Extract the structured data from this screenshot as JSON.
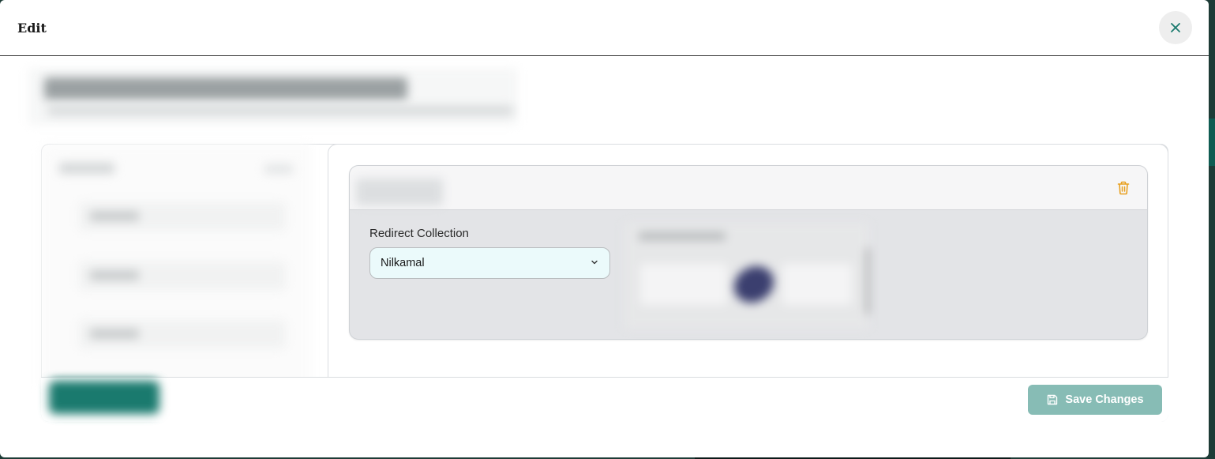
{
  "modal": {
    "title": "Edit",
    "close_icon": "close-icon"
  },
  "item": {
    "delete_icon": "trash-icon",
    "field": {
      "label": "Redirect Collection",
      "selected_value": "Nilkamal",
      "chevron_icon": "chevron-down-icon"
    }
  },
  "footer": {
    "save_label": "Save Changes",
    "save_icon": "floppy-disk-icon"
  },
  "colors": {
    "accent": "#1a7a6e",
    "save_button_disabled": "#87bcb5",
    "trash": "#e8a020",
    "select_bg": "#ebfafb"
  }
}
